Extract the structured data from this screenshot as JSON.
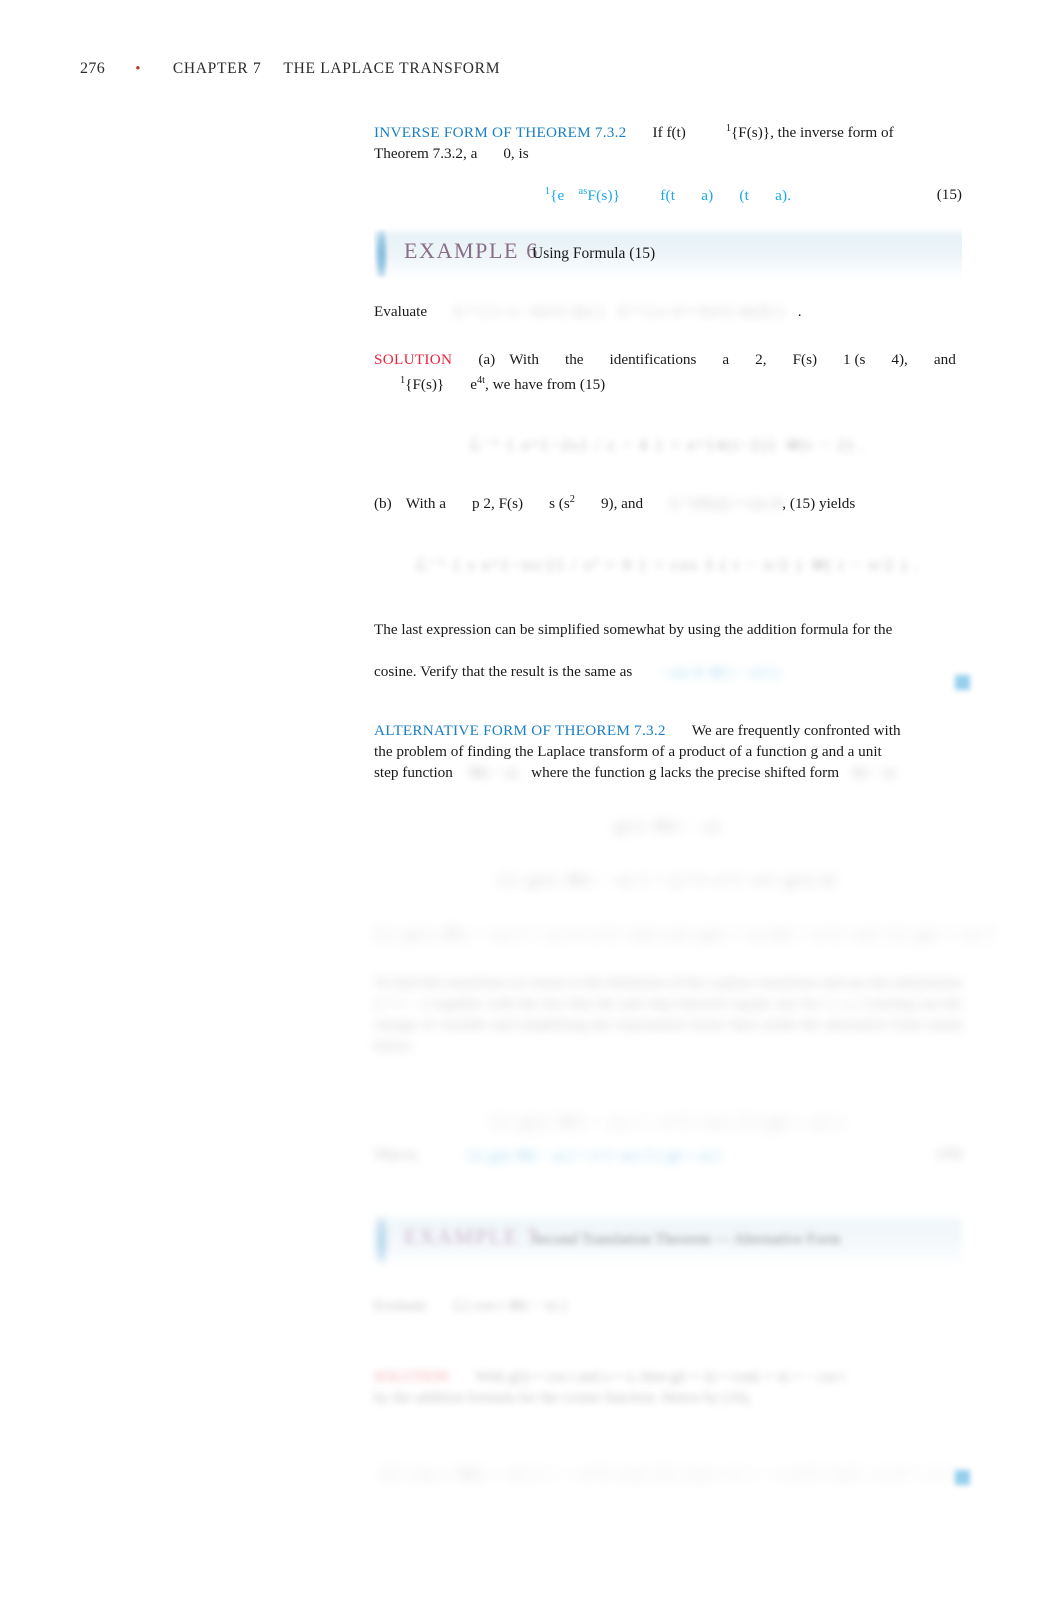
{
  "page": {
    "folio": "276",
    "separator": "•",
    "chapter": "CHAPTER 7",
    "chapter_title": "THE LAPLACE TRANSFORM"
  },
  "colors": {
    "heading_blue": "#1a7fc4",
    "equation_blue": "#17a9e8",
    "solution_red": "#e8243f",
    "example_purple": "#8a6d8a",
    "example_bar_blue": "#7fb9da",
    "endmark_blue": "#3fa9dd",
    "folio_bullet_red": "#c0392b"
  },
  "inverse_form": {
    "run_in": "INVERSE FORM OF THEOREM 7.3.2",
    "text_a": "If  f(t)",
    "text_b": "{F(s)}, the inverse form of",
    "text_c": "Theorem 7.3.2, a",
    "text_d": "0, is",
    "sup_one": "1"
  },
  "equation_15": {
    "sup_one": "1",
    "left": "{e",
    "sup_as": "as",
    "left_tail": "F(s)}",
    "right_a": "f(t",
    "right_b": "a)",
    "right_c": "(t",
    "right_d": "a).",
    "number": "(15)"
  },
  "example6": {
    "label": "EXAMPLE 6",
    "title": "Using Formula (15)",
    "evaluate_label": "Evaluate",
    "evaluate_math_a": "ℒ⁻¹ {  1 / s − 4  e^{−2s} }",
    "evaluate_math_b": "ℒ⁻¹ {  s / s² + 9  e^{−πs/2} }",
    "evaluate_period": "."
  },
  "solution_a": {
    "run_in": "SOLUTION",
    "part": "(a)",
    "text_1": "With",
    "text_2": "the",
    "text_3": "identifications",
    "text_4": "a",
    "text_5": "2,",
    "text_6": "F(s)",
    "text_7": "1 (s",
    "text_8": "4),",
    "text_9": "and",
    "line2_sup": "1",
    "line2_a": "{F(s)}",
    "line2_b": "e",
    "line2_sup2": "4t",
    "line2_c": ", we have from (15)",
    "display_math": "ℒ⁻¹ {  e^{−2s} / s − 4 } = e^{4(t−2)} 𝒰(t − 2) ."
  },
  "solution_b": {
    "part": "(b)",
    "text_1": "With a",
    "text_2": "p  2, F(s)",
    "text_3": "s  (s",
    "sup_2": "2",
    "text_4": "9), and",
    "math_inline": "ℒ⁻¹{F(s)} = cos 3t",
    "text_5": ", (15) yields",
    "display_math": "ℒ⁻¹ {  s e^{−πs/2} / s² + 9 } = cos 3 ( t − π/2 ) 𝒰( t − π/2 ) ."
  },
  "closing_para": {
    "line_1": "The last expression can be simplified somewhat by using the addition formula for the",
    "line_2": "cosine. Verify that the result is the same as",
    "trailing_math": "− sin 3t 𝒰( t − π/2 )."
  },
  "alternative_form": {
    "run_in": "ALTERNATIVE FORM OF THEOREM 7.3.2",
    "text_1": "We are frequently confronted with",
    "text_2": "the problem of finding the Laplace transform of a product of a function g and a unit",
    "text_3": "step function",
    "math_1": "𝒰(t − a)",
    "text_4": "where the function g lacks the precise shifted form",
    "math_2": "f(t − a)",
    "display_1": "g(t) 𝒰(t − a)",
    "display_2": "ℒ{ g(t) 𝒰(t − a) } = ∫ₐ^∞ e^{−st} g(t) dt",
    "display_3": "ℒ{ g(t) 𝒰(t − a) } = ∫₀^∞ e^{−s(u+a)} g(u + a) du = e^{−as} ℒ{ g(t + a) }",
    "blurred_paragraph": "To find this transform we return to the definition of the Laplace transform and use the substitution u = t − a together with the fact that the unit step function equals one for t ≥ a. Carrying out the change of variable and simplifying the exponential factor then yields the alternative form stated below.",
    "display_4": "ℒ{ g(t) 𝒰(t − a) } = e^{−as} ℒ{ g(t + a) }",
    "that_is_label": "That is,",
    "final_display": "ℒ{ g(t) 𝒰(t − a) } = e^{−as} ℒ{ g(t + a) }",
    "final_eqnum": "(16)"
  },
  "example7": {
    "label": "EXAMPLE 7",
    "title": "Second Translation Theorem — Alternative Form",
    "evaluate_label": "Evaluate",
    "evaluate_math": "ℒ{ cos t 𝒰(t − π) }",
    "solution_run_in": "SOLUTION",
    "solution_line_1": "With g(t) = cos t and a = π, then g(t + π) = cos(t + π) = − cos t",
    "solution_line_2": "by the addition formula for the cosine function. Hence by (16),",
    "display_math": "ℒ{ cos t 𝒰(t − π) } = − e^{−πs} ℒ{ cos t } = − s e^{−πs} / ( s² + 1 )"
  }
}
